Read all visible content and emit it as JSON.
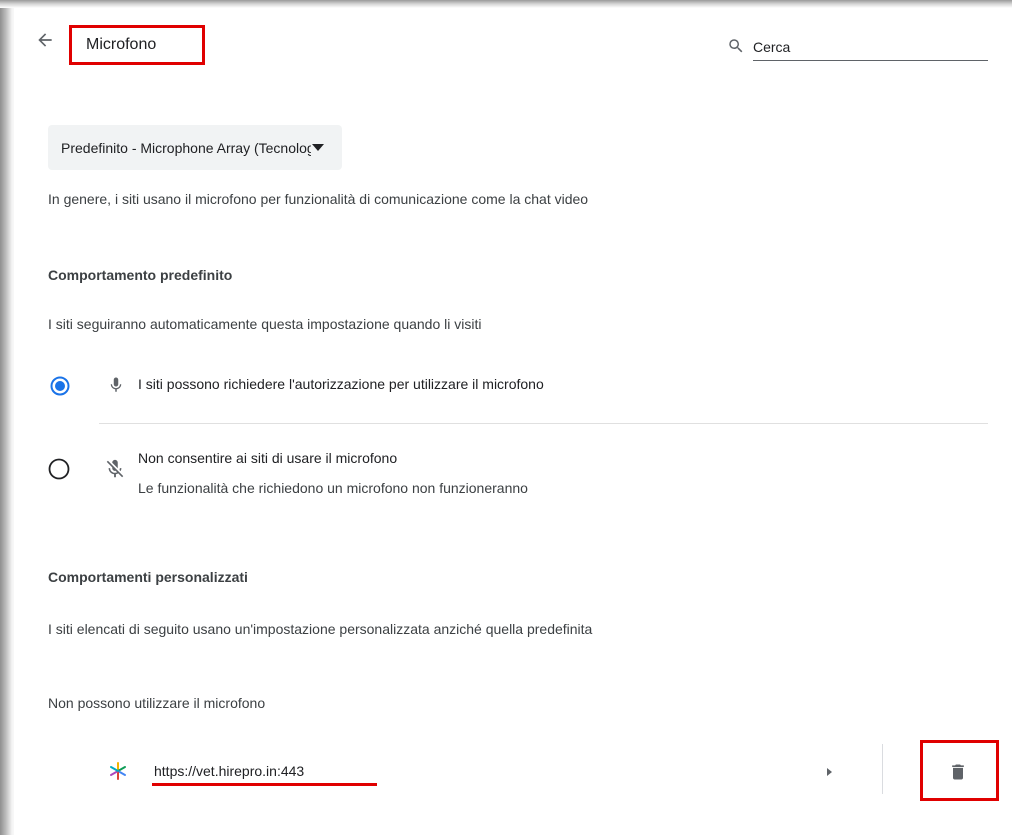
{
  "header": {
    "title": "Microfono",
    "back_icon": "arrow-back-icon",
    "search_placeholder": "Cerca",
    "search_icon": "search-icon"
  },
  "device_select": {
    "selected": "Predefinito - Microphone Array (Tecnologia Intel® Smart Sound per microfoni digitali)",
    "caret_icon": "triangle-down-icon"
  },
  "description": "In genere, i siti usano il microfono per funzionalità di comunicazione come la chat video",
  "default_behavior": {
    "heading": "Comportamento predefinito",
    "subtitle": "I siti seguiranno automaticamente questa impostazione quando li visiti",
    "options": [
      {
        "label": "I siti possono richiedere l'autorizzazione per utilizzare il microfono",
        "sublabel": "",
        "selected": true,
        "icon": "microphone-icon"
      },
      {
        "label": "Non consentire ai siti di usare il microfono",
        "sublabel": "Le funzionalità che richiedono un microfono non funzioneranno",
        "selected": false,
        "icon": "microphone-off-icon"
      }
    ]
  },
  "custom_behavior": {
    "heading": "Comportamenti personalizzati",
    "subtitle": "I siti elencati di seguito usano un'impostazione personalizzata anziché quella predefinita",
    "blocked_heading": "Non possono utilizzare il microfono",
    "sites": [
      {
        "url": "https://vet.hirepro.in:443",
        "favicon": "pinwheel-favicon-icon",
        "expand_icon": "arrow-right-icon",
        "delete_icon": "trash-icon"
      }
    ]
  },
  "colors": {
    "accent": "#1a73e8",
    "annotation": "#e00000",
    "text": "#3c4043"
  }
}
